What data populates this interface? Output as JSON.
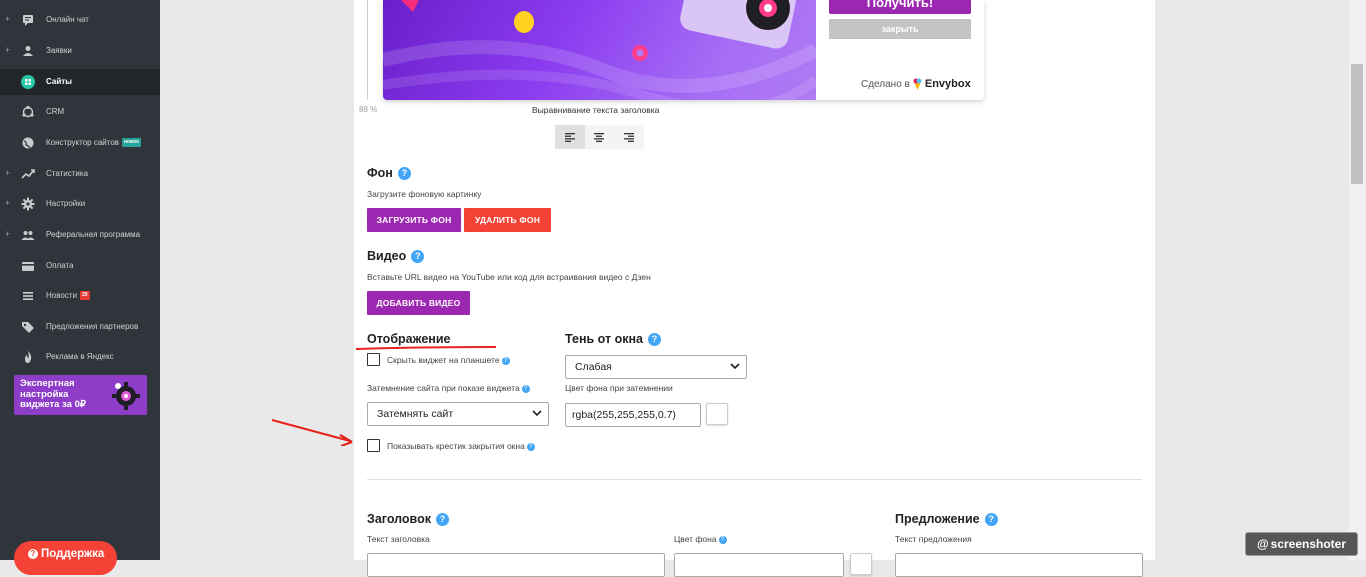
{
  "sidebar": {
    "items": [
      {
        "label": "Онлайн чат",
        "icon": "chat-icon",
        "plus": "+",
        "badge": ""
      },
      {
        "label": "Заявки",
        "icon": "person-icon",
        "plus": "+",
        "badge": ""
      },
      {
        "label": "Сайты",
        "icon": "sites-grid-icon",
        "plus": "",
        "badge": "",
        "active": true
      },
      {
        "label": "CRM",
        "icon": "crm-icon",
        "plus": "",
        "badge": ""
      },
      {
        "label": "Конструктор сайтов",
        "icon": "globe-icon",
        "plus": "",
        "badge": "новое"
      },
      {
        "label": "Статистика",
        "icon": "trend-icon",
        "plus": "+",
        "badge": ""
      },
      {
        "label": "Настройки",
        "icon": "gear-icon",
        "plus": "+",
        "badge": ""
      },
      {
        "label": "Реферальная программа",
        "icon": "people-icon",
        "plus": "+",
        "badge": ""
      },
      {
        "label": "Оплата",
        "icon": "card-icon",
        "plus": "",
        "badge": ""
      },
      {
        "label": "Новости",
        "icon": "list-icon",
        "plus": "",
        "badge": "20"
      },
      {
        "label": "Предложения партнеров",
        "icon": "tag-icon",
        "plus": "",
        "badge": ""
      },
      {
        "label": "Реклама в Яндекс",
        "icon": "flame-icon",
        "plus": "",
        "badge": ""
      }
    ],
    "promo_text": "Экспертная настройка виджета за 0₽",
    "support_label": "Поддержка",
    "support_icon": "question-icon"
  },
  "preview": {
    "get_button": "Получить!",
    "close_button": "закрыть",
    "made_by_prefix": "Сделано в",
    "made_by_brand": "Envybox",
    "zoom": "88 %"
  },
  "title_alignment": {
    "label": "Выравнивание текста заголовка",
    "options": [
      "left",
      "center",
      "right"
    ],
    "selected": "left"
  },
  "background": {
    "title": "Фон",
    "hint": "Загрузите фоновую картинку",
    "upload_button": "ЗАГРУЗИТЬ ФОН",
    "delete_button": "УДАЛИТЬ ФОН"
  },
  "video": {
    "title": "Видео",
    "hint": "Вставьте URL видео на YouTube или код для встраивания видео с Дзен",
    "add_button": "ДОБАВИТЬ ВИДЕО"
  },
  "display": {
    "title": "Отображение",
    "hide_tablet_label": "Скрыть виджет на планшете",
    "hide_tablet_checked": false,
    "dim_label": "Затемнение сайта при показе виджета",
    "dim_value": "Затемнять сайт",
    "show_close_label": "Показывать крестик закрытия окна",
    "show_close_checked": false
  },
  "shadow": {
    "title": "Тень от окна",
    "value": "Слабая",
    "dim_color_label": "Цвет фона при затемнении",
    "dim_color_value": "rgba(255,255,255,0.7)"
  },
  "headline": {
    "title": "Заголовок",
    "text_label": "Текст заголовка",
    "bg_color_label": "Цвет фона"
  },
  "offer": {
    "title": "Предложение",
    "text_label": "Текст предложения"
  },
  "watermark": "screenshoter",
  "colors": {
    "accent_purple": "#9c27b0",
    "danger_red": "#f44336",
    "help_blue": "#42a5f5",
    "annotation_red": "#e8221c",
    "sidebar_bg": "#2f353b"
  }
}
